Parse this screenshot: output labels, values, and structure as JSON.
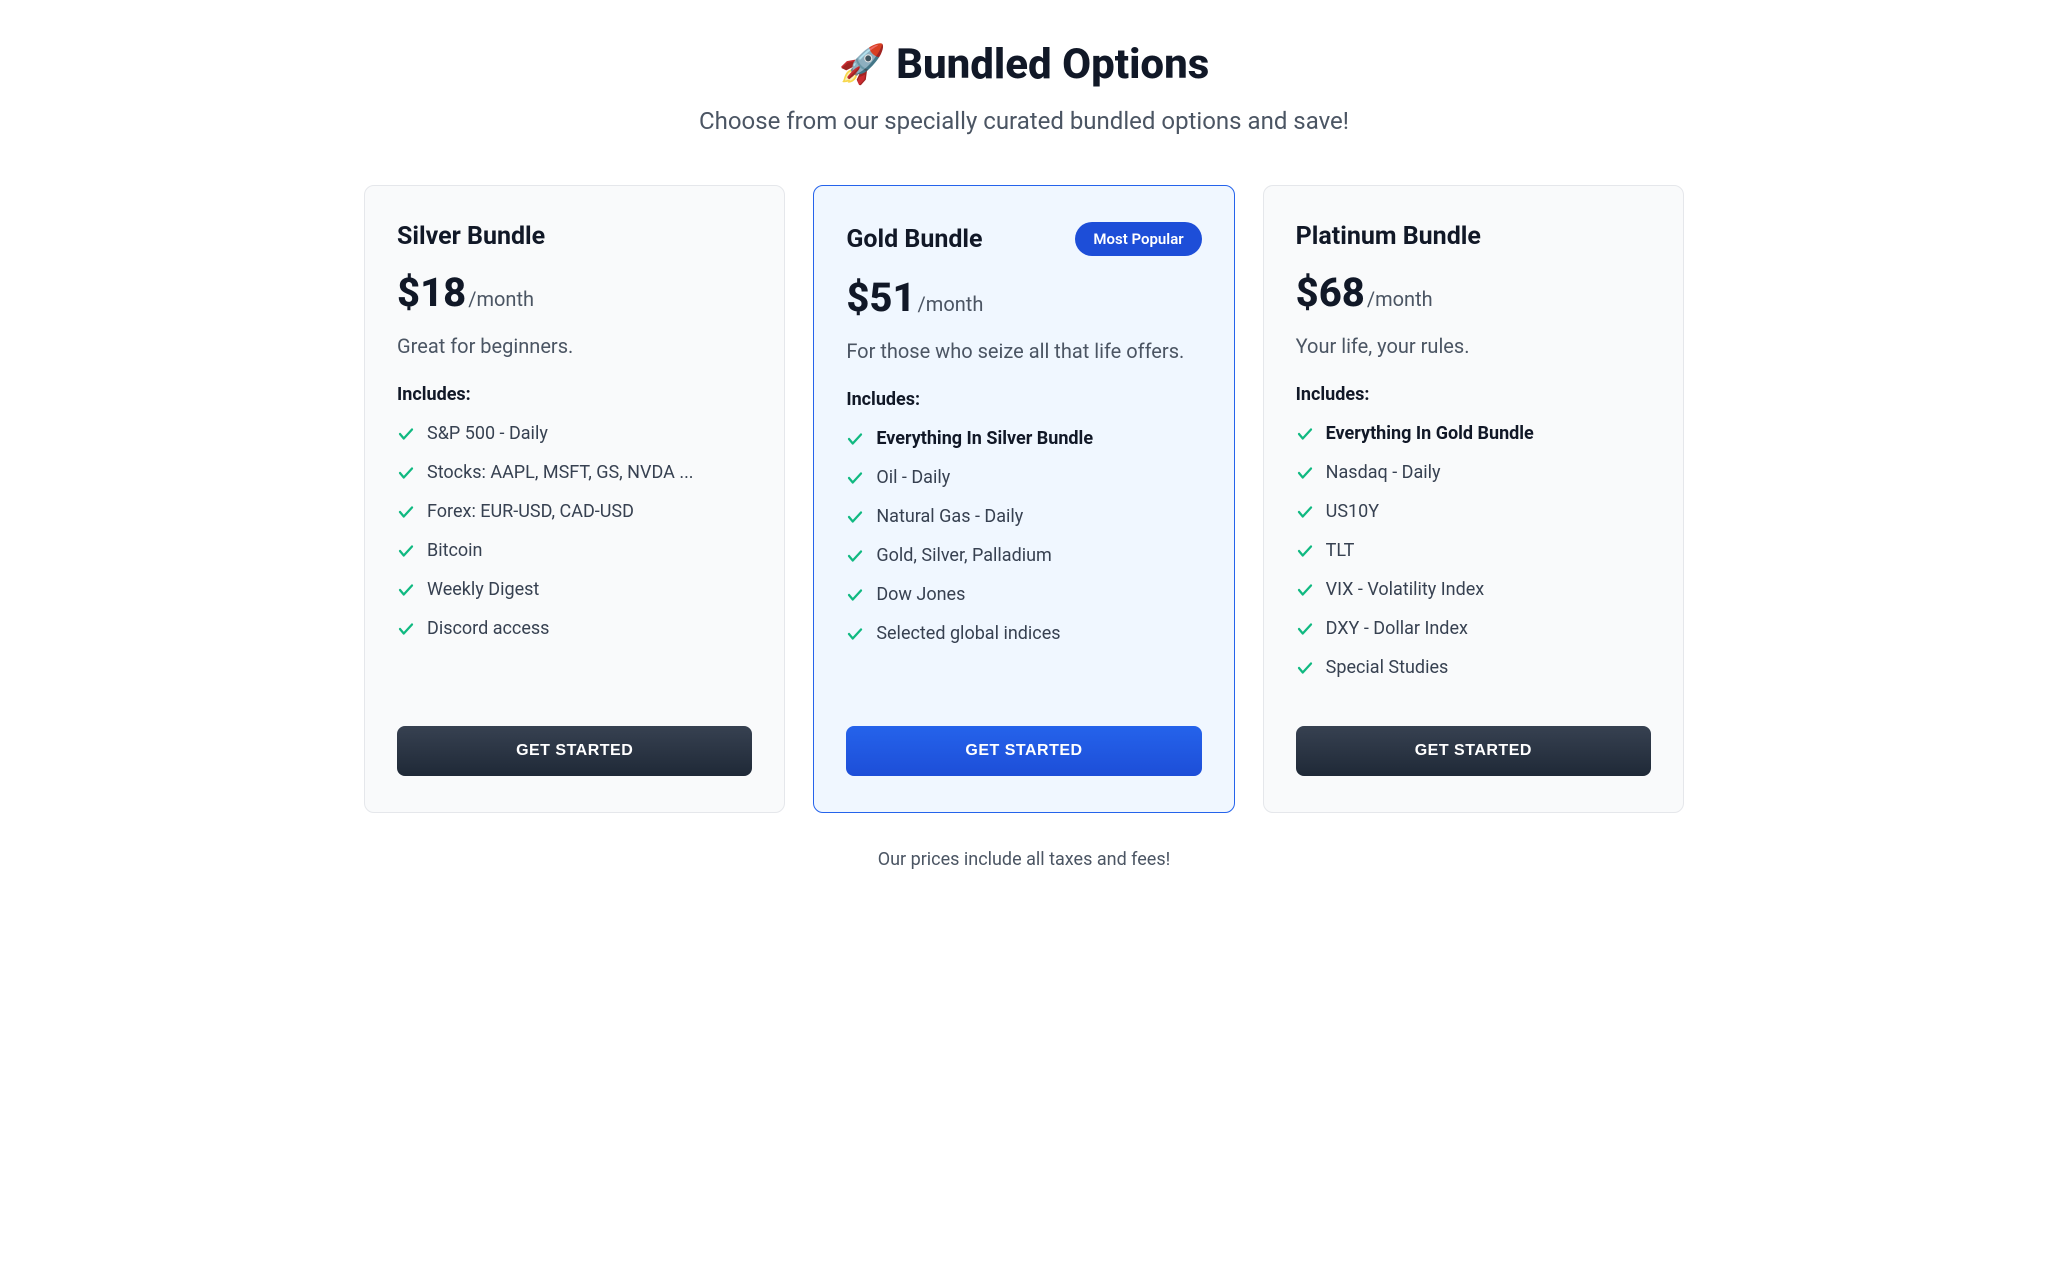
{
  "header": {
    "icon": "🚀",
    "title": "Bundled Options",
    "subtitle": "Choose from our specially curated bundled options and save!"
  },
  "bundles": [
    {
      "name": "Silver Bundle",
      "price": "$18",
      "period": "/month",
      "description": "Great for beginners.",
      "includes_label": "Includes:",
      "features": [
        {
          "text": "S&P 500 - Daily",
          "bold": false
        },
        {
          "text": "Stocks: AAPL, MSFT, GS, NVDA ...",
          "bold": false
        },
        {
          "text": "Forex: EUR-USD, CAD-USD",
          "bold": false
        },
        {
          "text": "Bitcoin",
          "bold": false
        },
        {
          "text": "Weekly Digest",
          "bold": false
        },
        {
          "text": "Discord access",
          "bold": false
        }
      ],
      "cta": "GET STARTED",
      "highlight": false,
      "badge": null
    },
    {
      "name": "Gold Bundle",
      "price": "$51",
      "period": "/month",
      "description": "For those who seize all that life offers.",
      "includes_label": "Includes:",
      "features": [
        {
          "text": "Everything In Silver Bundle",
          "bold": true
        },
        {
          "text": "Oil - Daily",
          "bold": false
        },
        {
          "text": "Natural Gas - Daily",
          "bold": false
        },
        {
          "text": "Gold, Silver, Palladium",
          "bold": false
        },
        {
          "text": "Dow Jones",
          "bold": false
        },
        {
          "text": "Selected global indices",
          "bold": false
        }
      ],
      "cta": "GET STARTED",
      "highlight": true,
      "badge": "Most Popular"
    },
    {
      "name": "Platinum Bundle",
      "price": "$68",
      "period": "/month",
      "description": "Your life, your rules.",
      "includes_label": "Includes:",
      "features": [
        {
          "text": "Everything In Gold Bundle",
          "bold": true
        },
        {
          "text": "Nasdaq - Daily",
          "bold": false
        },
        {
          "text": "US10Y",
          "bold": false
        },
        {
          "text": "TLT",
          "bold": false
        },
        {
          "text": "VIX - Volatility Index",
          "bold": false
        },
        {
          "text": "DXY - Dollar Index",
          "bold": false
        },
        {
          "text": "Special Studies",
          "bold": false
        }
      ],
      "cta": "GET STARTED",
      "highlight": false,
      "badge": null
    }
  ],
  "footer_note": "Our prices include all taxes and fees!"
}
